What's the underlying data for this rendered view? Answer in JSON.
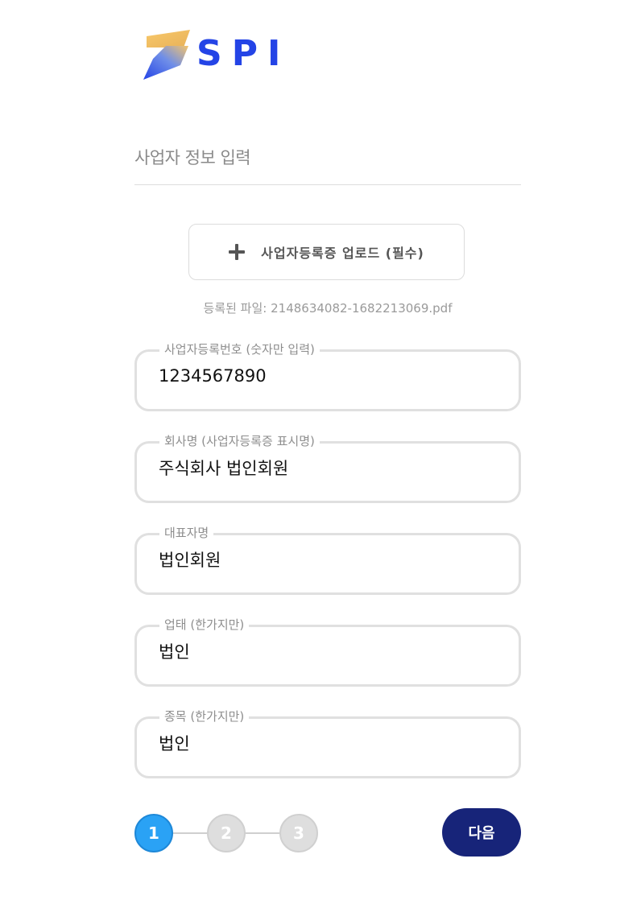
{
  "logo": {
    "text": "SPI",
    "brand_color": "#2444e6",
    "accent_color": "#f6c46a"
  },
  "page": {
    "title": "사업자 정보 입력"
  },
  "upload": {
    "icon": "plus-icon",
    "label": "사업자등록증 업로드 (필수)",
    "file_note": "등록된 파일: 2148634082-1682213069.pdf"
  },
  "fields": [
    {
      "legend": "사업자등록번호 (숫자만 입력)",
      "value": "1234567890"
    },
    {
      "legend": "회사명 (사업자등록증 표시명)",
      "value": "주식회사 법인회원"
    },
    {
      "legend": "대표자명",
      "value": "법인회원"
    },
    {
      "legend": "업태 (한가지만)",
      "value": "법인"
    },
    {
      "legend": "종목 (한가지만)",
      "value": "법인"
    }
  ],
  "stepper": {
    "steps": [
      "1",
      "2",
      "3"
    ],
    "current_step": 1,
    "active_color": "#2aa2f5",
    "inactive_color": "#dedede"
  },
  "actions": {
    "next_label": "다음",
    "next_color": "#172479"
  }
}
